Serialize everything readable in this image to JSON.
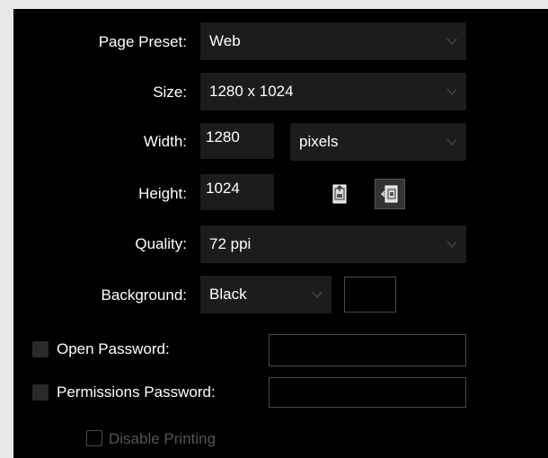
{
  "labels": {
    "page_preset": "Page Preset:",
    "size": "Size:",
    "width": "Width:",
    "height": "Height:",
    "quality": "Quality:",
    "background": "Background:",
    "open_password": "Open Password:",
    "permissions_password": "Permissions Password:",
    "disable_printing": "Disable Printing"
  },
  "values": {
    "page_preset": "Web",
    "size": "1280 x 1024",
    "width": "1280",
    "units": "pixels",
    "height": "1024",
    "quality": "72 ppi",
    "background": "Black",
    "open_password": "",
    "permissions_password": ""
  },
  "icons": {
    "portrait": "portrait-orientation-icon",
    "landscape": "landscape-orientation-icon",
    "chevron": "chevron-down-icon"
  },
  "state": {
    "open_password_checked": false,
    "permissions_password_checked": false,
    "disable_printing_enabled": false,
    "landscape_selected": true
  },
  "colors": {
    "panel_background": "#000000",
    "field_background": "#1c1c1c",
    "background_swatch": "#000000",
    "disabled_text": "#555555"
  }
}
